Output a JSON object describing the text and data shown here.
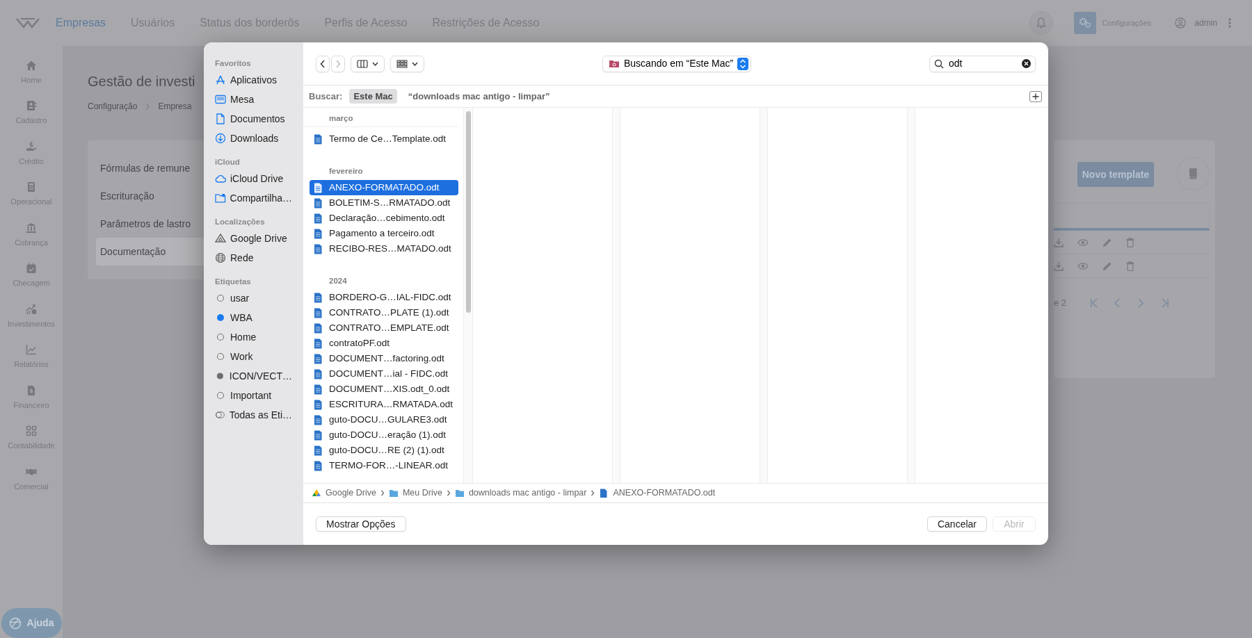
{
  "app": {
    "nav": [
      {
        "label": "Empresas",
        "selected": true
      },
      {
        "label": "Usuários",
        "selected": false
      },
      {
        "label": "Status dos borderôs",
        "selected": false
      },
      {
        "label": "Perfis de Acesso",
        "selected": false
      },
      {
        "label": "Restrições de Acesso",
        "selected": false
      }
    ],
    "settings_label": "Configurações",
    "user": "admin",
    "sidebar": [
      {
        "label": "Home"
      },
      {
        "label": "Cadastro"
      },
      {
        "label": "Crédito"
      },
      {
        "label": "Operacional"
      },
      {
        "label": "Cobrança"
      },
      {
        "label": "Checagem"
      },
      {
        "label": "Investimentos"
      },
      {
        "label": "Relatórios"
      },
      {
        "label": "Financeiro"
      },
      {
        "label": "Contabilidade"
      },
      {
        "label": "Comercial"
      }
    ],
    "help_button": "Ajuda",
    "page": {
      "title": "Gestão de investi",
      "breadcrumb": [
        "Configuração",
        "Empresa"
      ],
      "menu": [
        {
          "label": "Fórmulas de remune",
          "selected": false
        },
        {
          "label": "Escrituração",
          "selected": false
        },
        {
          "label": "Parâmetros de lastro",
          "selected": false
        },
        {
          "label": "Documentação",
          "selected": true
        }
      ],
      "new_button": "Novo template",
      "pagination_text": "e 2"
    }
  },
  "dialog": {
    "sidebar": [
      {
        "heading": "Favoritos",
        "items": [
          {
            "label": "Aplicativos",
            "kind": "place"
          },
          {
            "label": "Mesa",
            "kind": "place"
          },
          {
            "label": "Documentos",
            "kind": "place"
          },
          {
            "label": "Downloads",
            "kind": "place"
          }
        ]
      },
      {
        "heading": "iCloud",
        "items": [
          {
            "label": "iCloud Drive",
            "kind": "place"
          },
          {
            "label": "Compartilha…",
            "kind": "place"
          }
        ]
      },
      {
        "heading": "Localizações",
        "items": [
          {
            "label": "Google Drive",
            "kind": "place"
          },
          {
            "label": "Rede",
            "kind": "place"
          }
        ]
      },
      {
        "heading": "Etiquetas",
        "items": [
          {
            "label": "usar",
            "kind": "tag"
          },
          {
            "label": "WBA",
            "kind": "tag",
            "color": "#1a7cf0"
          },
          {
            "label": "Home",
            "kind": "tag"
          },
          {
            "label": "Work",
            "kind": "tag"
          },
          {
            "label": "ICON/VECT…",
            "kind": "tag",
            "color": "#6e6e72"
          },
          {
            "label": "Important",
            "kind": "tag"
          },
          {
            "label": "Todas as Eti…",
            "kind": "all-tags"
          }
        ]
      }
    ],
    "location": "Buscando em “Este Mac”",
    "search": {
      "value": "odt"
    },
    "scope_label": "Buscar:",
    "scopes": [
      {
        "label": "Este Mac",
        "selected": true
      },
      {
        "label": "“downloads mac antigo - limpar”",
        "selected": false
      }
    ],
    "groups": [
      {
        "heading": "março",
        "files": [
          {
            "name": "Termo de Ce…Template.odt",
            "selected": false
          }
        ]
      },
      {
        "heading": "fevereiro",
        "files": [
          {
            "name": "ANEXO-FORMATADO.odt",
            "selected": true
          },
          {
            "name": "BOLETIM-S…RMATADO.odt",
            "selected": false
          },
          {
            "name": "Declaração…cebimento.odt",
            "selected": false
          },
          {
            "name": "Pagamento a terceiro.odt",
            "selected": false
          },
          {
            "name": "RECIBO-RES…MATADO.odt",
            "selected": false
          }
        ]
      },
      {
        "heading": "2024",
        "files": [
          {
            "name": "BORDERO-G…IAL-FIDC.odt",
            "selected": false
          },
          {
            "name": "CONTRATO…PLATE (1).odt",
            "selected": false
          },
          {
            "name": "CONTRATO…EMPLATE.odt",
            "selected": false
          },
          {
            "name": "contratoPF.odt",
            "selected": false
          },
          {
            "name": "DOCUMENT…factoring.odt",
            "selected": false
          },
          {
            "name": "DOCUMENT…ial - FIDC.odt",
            "selected": false
          },
          {
            "name": "DOCUMENT…XIS.odt_0.odt",
            "selected": false
          },
          {
            "name": "ESCRITURA…RMATADA.odt",
            "selected": false
          },
          {
            "name": "guto-DOCU…GULARE3.odt",
            "selected": false
          },
          {
            "name": "guto-DOCU…eração (1).odt",
            "selected": false
          },
          {
            "name": "guto-DOCU…RE (2) (1).odt",
            "selected": false
          },
          {
            "name": "TERMO-FOR…-LINEAR.odt",
            "selected": false
          }
        ]
      }
    ],
    "path": [
      "Google Drive",
      "Meu Drive",
      "downloads mac antigo - limpar",
      "ANEXO-FORMATADO.odt"
    ],
    "options_button": "Mostrar Opções",
    "cancel_button": "Cancelar",
    "open_button": {
      "label": "Abrir",
      "disabled": true
    }
  }
}
